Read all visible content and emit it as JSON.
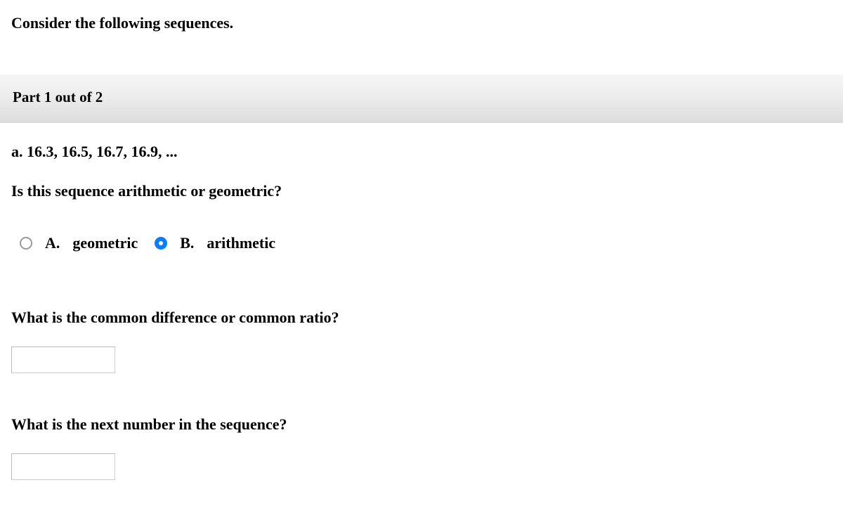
{
  "instruction": "Consider the following sequences.",
  "partHeader": "Part 1 out of 2",
  "sequenceLine": "a. 16.3, 16.5, 16.7, 16.9, ...",
  "questionType": "Is this sequence arithmetic or geometric?",
  "options": {
    "a": {
      "letter": "A.",
      "label": "geometric"
    },
    "b": {
      "letter": "B.",
      "label": "arithmetic"
    }
  },
  "selected": "b",
  "q2": "What is the common difference or common ratio?",
  "q2_value": "",
  "q3": "What is the next number in the sequence?",
  "q3_value": ""
}
